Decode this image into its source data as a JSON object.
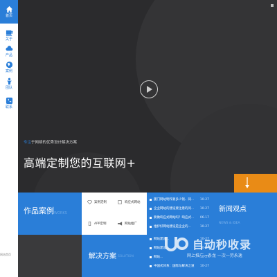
{
  "nav": {
    "items": [
      {
        "label": "首页",
        "icon": "home-icon"
      },
      {
        "label": "关于",
        "icon": "cup-icon"
      },
      {
        "label": "产品",
        "icon": "cloud-icon"
      },
      {
        "label": "案例",
        "icon": "globe-icon"
      },
      {
        "label": "团队",
        "icon": "person-icon"
      },
      {
        "label": "联系",
        "icon": "phone-icon"
      }
    ],
    "bottom_text": "网站首页"
  },
  "hero": {
    "focus_prefix": "专注",
    "focus_text": "于网络的优秀设计解决方案",
    "slogan": "高端定制您的互联网+"
  },
  "works": {
    "title": "作品案例",
    "subtitle": "WORKS"
  },
  "categories": [
    {
      "label": "案例定制",
      "icon": "diamond-icon"
    },
    {
      "label": "响应式网站",
      "icon": "doc-icon"
    },
    {
      "label": "APP定制",
      "icon": "mobile-icon"
    },
    {
      "label": "网站推广",
      "icon": "megaphone-icon"
    }
  ],
  "solution": {
    "title": "解决方案",
    "subtitle": "SOLUTION"
  },
  "news": {
    "title": "新闻观点",
    "subtitle": "NEWS & IDEA",
    "items": [
      {
        "title": "厦门网站制作要多少钱、同…",
        "date": "10-27"
      },
      {
        "title": "企业网站的建设要注意的问…",
        "date": "10-27"
      },
      {
        "title": "要做响应式网站吗？响应式…",
        "date": "06-17"
      },
      {
        "title": "维护好网站建设是企业的…",
        "date": "10-27"
      },
      {
        "title": "网站建设…",
        "date": "10-27"
      },
      {
        "title": "网站建设…",
        "date": "10-27"
      },
      {
        "title": "网站…",
        "date": "10-27"
      },
      {
        "title": "中国式体系：国际与解决之道",
        "date": "10-27"
      }
    ]
  },
  "watermark": {
    "title": "自动秒收录",
    "subtitle": "网上推广一条龙 一次一劳永逸"
  },
  "colors": {
    "accent": "#2a7ed8",
    "orange": "#e98b16",
    "dark": "#2b2b2d"
  }
}
